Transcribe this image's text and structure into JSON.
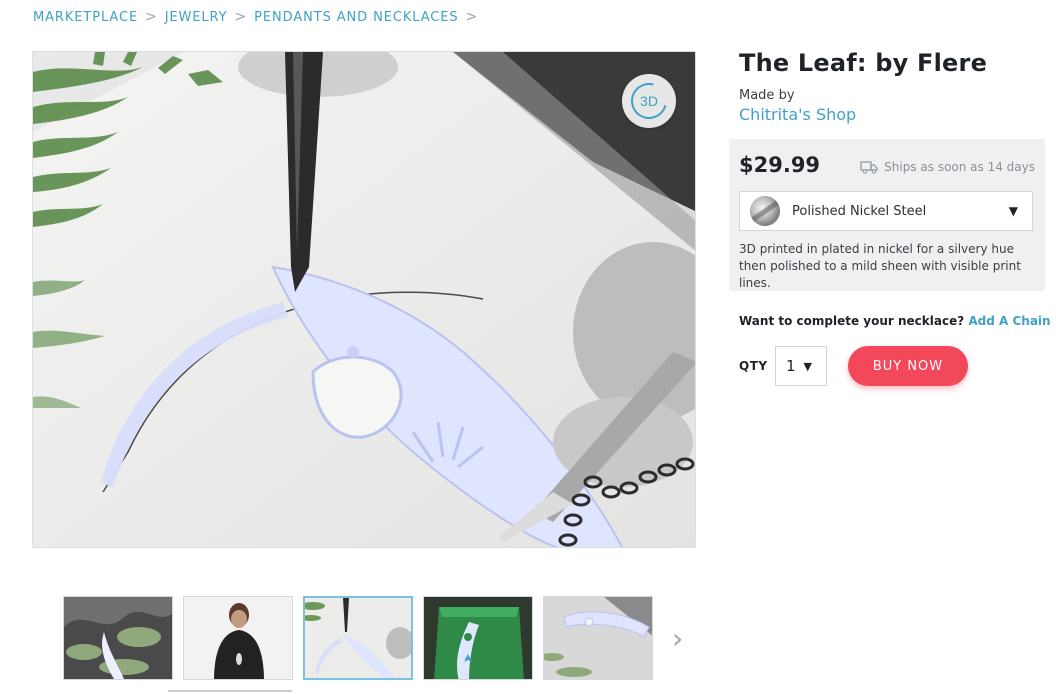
{
  "breadcrumb": {
    "items": [
      "MARKETPLACE",
      "JEWELRY",
      "PENDANTS AND NECKLACES"
    ],
    "separator": ">"
  },
  "viewer": {
    "button_3d_label": "3D"
  },
  "product": {
    "title": "The Leaf: by Flere",
    "made_by_label": "Made by",
    "shop_name": "Chitrita's Shop",
    "price": "$29.99",
    "shipping": "Ships as soon as 14 days",
    "variant": {
      "selected": "Polished Nickel Steel",
      "description": "3D printed in plated in nickel for a silvery hue then polished to a mild sheen with visible print lines."
    },
    "complete_prompt": "Want to complete your necklace?",
    "complete_link": "Add A Chain",
    "qty_label": "QTY",
    "qty_value": "1",
    "buy_label": "BUY NOW"
  },
  "thumbnails": {
    "count": 5,
    "active_index": 2,
    "next_icon": "chevron-right-icon"
  },
  "colors": {
    "accent": "#3fa1c9",
    "buy_button": "#f3475a",
    "price_box_bg": "#eef0f2"
  }
}
